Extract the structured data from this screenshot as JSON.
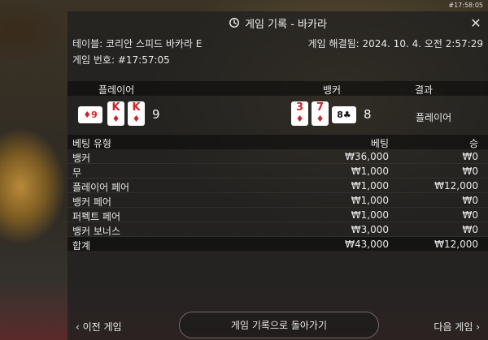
{
  "top_timestamp": "#17:58:05",
  "header": {
    "title": "게임 기록 - 바카라",
    "close": "✕"
  },
  "info": {
    "table_label": "테이블: 코리안 스피드 바카라 E",
    "settled_label": "게임 해결됨: 2024. 10. 4. 오전 2:57:29",
    "game_no_label": "게임 번호: #17:57:05"
  },
  "cards_head": {
    "player": "플레이어",
    "banker": "뱅커",
    "result": "결과"
  },
  "player": {
    "cards": [
      {
        "rank": "K",
        "suit": "♦",
        "color": "#d3202a"
      },
      {
        "rank": "K",
        "suit": "♦",
        "color": "#d3202a"
      }
    ],
    "side_card": {
      "rank": "9",
      "suit": "♦",
      "color": "#d3202a"
    },
    "total": "9"
  },
  "banker": {
    "cards": [
      {
        "rank": "3",
        "suit": "♦",
        "color": "#d3202a"
      },
      {
        "rank": "7",
        "suit": "♦",
        "color": "#d3202a"
      }
    ],
    "side_card": {
      "rank": "8",
      "suit": "♣",
      "color": "#111111"
    },
    "total": "8"
  },
  "result": "플레이어",
  "bets": {
    "headers": {
      "type": "베팅 유형",
      "bet": "베팅",
      "win": "승"
    },
    "rows": [
      {
        "type": "뱅커",
        "bet": "₩36,000",
        "win": "₩0"
      },
      {
        "type": "무",
        "bet": "₩1,000",
        "win": "₩0"
      },
      {
        "type": "플레이어 페어",
        "bet": "₩1,000",
        "win": "₩12,000"
      },
      {
        "type": "뱅커 페어",
        "bet": "₩1,000",
        "win": "₩0"
      },
      {
        "type": "퍼펙트 페어",
        "bet": "₩1,000",
        "win": "₩0"
      },
      {
        "type": "뱅커 보너스",
        "bet": "₩3,000",
        "win": "₩0"
      }
    ],
    "total": {
      "type": "합계",
      "bet": "₩43,000",
      "win": "₩12,000"
    }
  },
  "footer": {
    "prev": "‹  이전 게임",
    "back": "게임 기록으로 돌아가기",
    "next": "다음 게임  ›"
  }
}
